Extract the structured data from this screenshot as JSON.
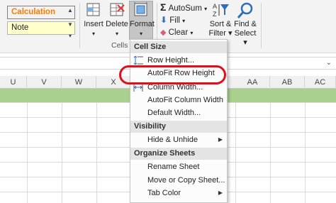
{
  "ribbon": {
    "styles": {
      "calculation": "Calculation",
      "note": "Note"
    },
    "cells_group": {
      "label": "Cells",
      "insert": "Insert",
      "delete": "Delete",
      "format": "Format"
    },
    "editing": {
      "autosum": "AutoSum",
      "fill": "Fill",
      "clear": "Clear",
      "sort_filter": "Sort &",
      "sort_filter_2": "Filter",
      "find_select": "Find &",
      "find_select_2": "Select"
    }
  },
  "sheet": {
    "columns": [
      "U",
      "V",
      "W",
      "X",
      "",
      "",
      "AA",
      "AB",
      "AC"
    ],
    "header_fill_color": "#a9d08e"
  },
  "format_menu": {
    "sections": {
      "cell_size": "Cell Size",
      "visibility": "Visibility",
      "organize": "Organize Sheets"
    },
    "items": {
      "row_height": "Row Height...",
      "autofit_row_height": "AutoFit Row Height",
      "column_width": "Column Width...",
      "autofit_column_width": "AutoFit Column Width",
      "default_width": "Default Width...",
      "hide_unhide": "Hide & Unhide",
      "rename_sheet": "Rename Sheet",
      "move_copy_sheet": "Move or Copy Sheet...",
      "tab_color": "Tab Color"
    },
    "highlighted_item_color": "#e0101a"
  }
}
